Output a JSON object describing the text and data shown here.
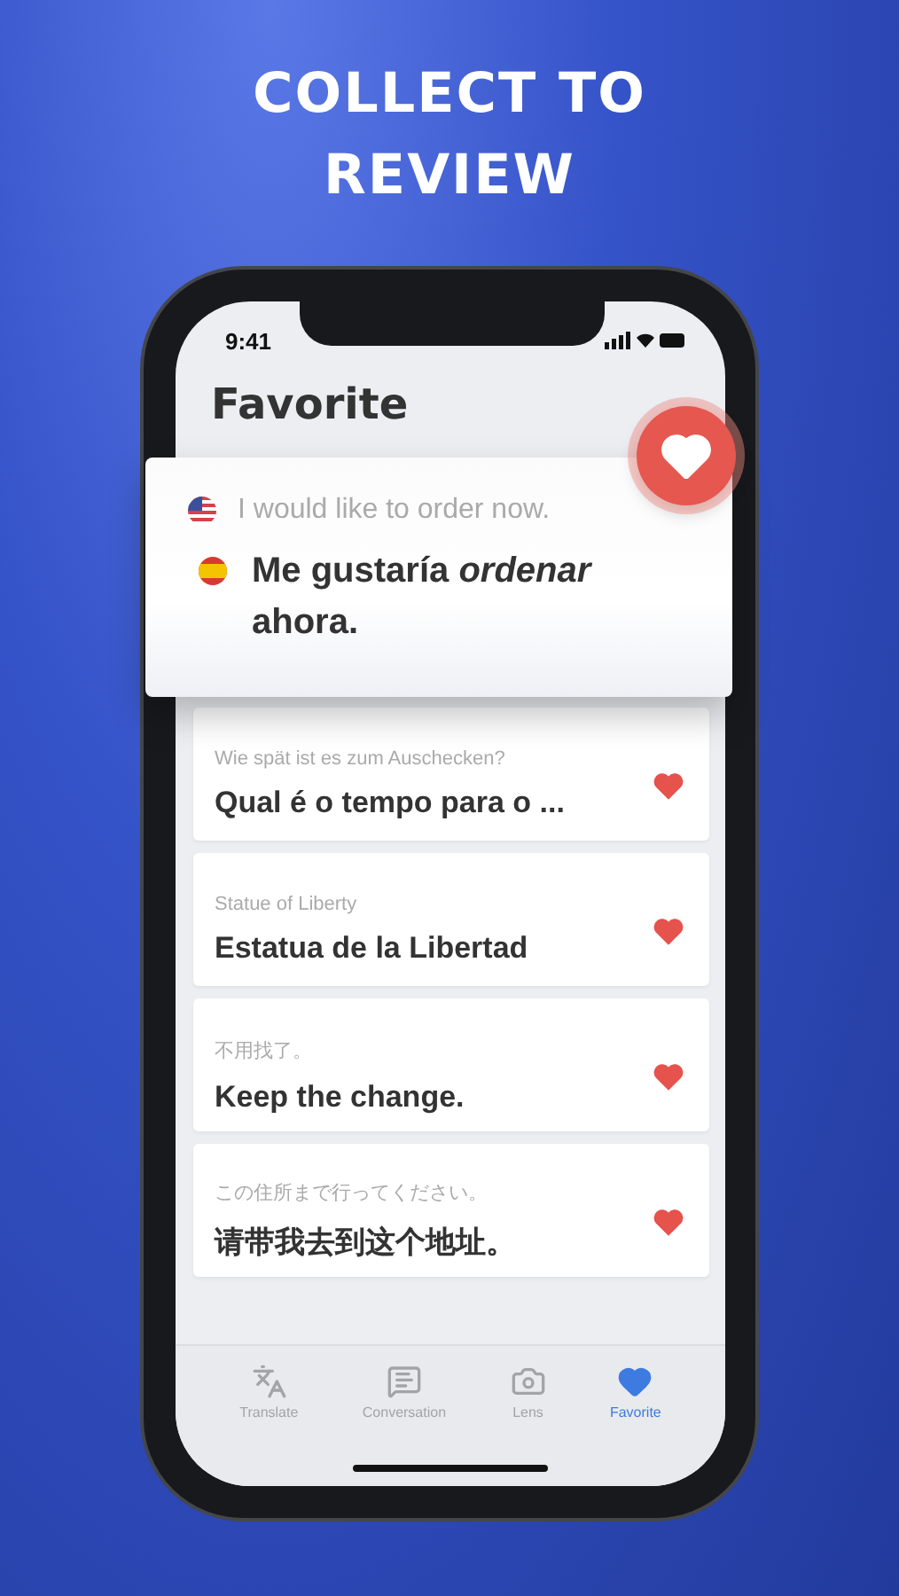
{
  "headline": [
    "COLLECT TO",
    "REVIEW"
  ],
  "status_bar": {
    "time": "9:41"
  },
  "title": "Favorite",
  "featured": {
    "source": "I would like to order now.",
    "translation": "Me gustaría *ordenar* ahora.",
    "favorite": true
  },
  "items": [
    {
      "source": "Wie spät ist es zum Auschecken?",
      "translation": "Qual é o tempo para o ...",
      "favorite": true
    },
    {
      "source": "Statue of Liberty",
      "translation": "Estatua de la Libertad",
      "favorite": true
    },
    {
      "source": "不用找了。",
      "translation": "Keep the change.",
      "favorite": true
    },
    {
      "source": "この住所まで行ってください。",
      "translation": "请带我去到这个地址。",
      "favorite": true
    }
  ],
  "tabs": [
    {
      "kind": "translate",
      "label": "Translate",
      "selected": false
    },
    {
      "kind": "conversation",
      "label": "Conversation",
      "selected": false
    },
    {
      "kind": "lens",
      "label": "Lens",
      "selected": false
    },
    {
      "kind": "favorite",
      "label": "Favorite",
      "selected": true
    }
  ]
}
